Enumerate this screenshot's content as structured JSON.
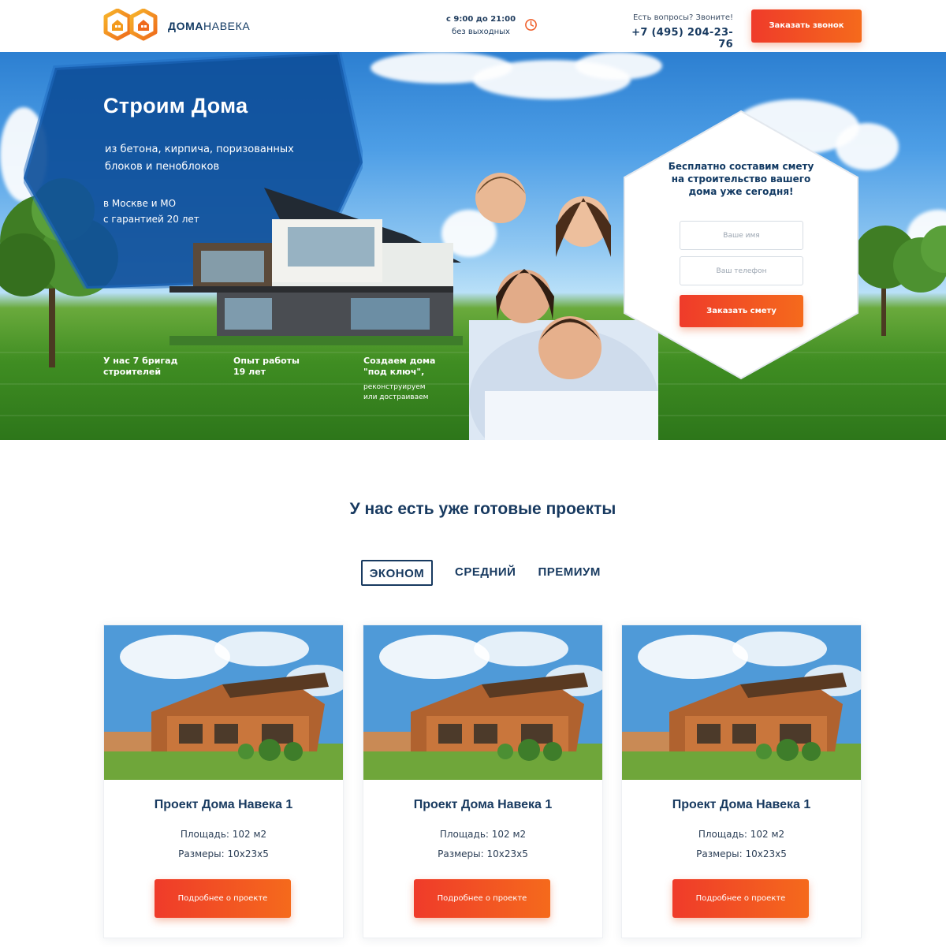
{
  "header": {
    "logo": {
      "bold": "ДОМА",
      "light": "НАВЕКА",
      "icon": "house-hexagon-logo"
    },
    "hours": {
      "time": "с 9:00 до 21:00",
      "days": "без выходных",
      "icon": "clock-icon"
    },
    "contact": {
      "question": "Есть вопросы? Звоните!",
      "phone": "+7 (495) 204-23-76"
    },
    "call_button": "Заказать звонок"
  },
  "hero": {
    "title": "Строим Дома",
    "subtitle": "из бетона, кирпича, поризованных блоков и пеноблоков",
    "location_line1": "в Москве и МО",
    "location_line2": "с гарантией 20 лет",
    "features": [
      {
        "line1": "У нас 7 бригад",
        "line2": "строителей",
        "small": ""
      },
      {
        "line1": "Опыт работы",
        "line2": "19 лет",
        "small": ""
      },
      {
        "line1": "Создаем дома",
        "line2": "\"под ключ\",",
        "small1": "реконструируем",
        "small2": "или достраиваем"
      }
    ]
  },
  "form": {
    "title": "Бесплатно составим смету на строительство вашего дома уже сегодня!",
    "name_placeholder": "Ваше имя",
    "phone_placeholder": "Ваш телефон",
    "submit": "Заказать смету"
  },
  "projects": {
    "title": "У нас есть уже готовые проекты",
    "tabs": [
      "ЭКОНОМ",
      "СРЕДНИЙ",
      "ПРЕМИУМ"
    ],
    "active_tab": "ЭКОНОМ",
    "cards": [
      {
        "title": "Проект Дома Навека 1",
        "area": "Площадь: 102 м2",
        "size": "Размеры: 10x23x5",
        "button": "Подробнее о проекте"
      },
      {
        "title": "Проект Дома Навека 1",
        "area": "Площадь: 102 м2",
        "size": "Размеры: 10x23x5",
        "button": "Подробнее о проекте"
      },
      {
        "title": "Проект Дома Навека 1",
        "area": "Площадь: 102 м2",
        "size": "Размеры: 10x23x5",
        "button": "Подробнее о проекте"
      }
    ]
  },
  "colors": {
    "navy": "#183a60",
    "accent_start": "#ef3b2a",
    "accent_end": "#f56a1c",
    "logo_orange": "#f39a1c"
  }
}
